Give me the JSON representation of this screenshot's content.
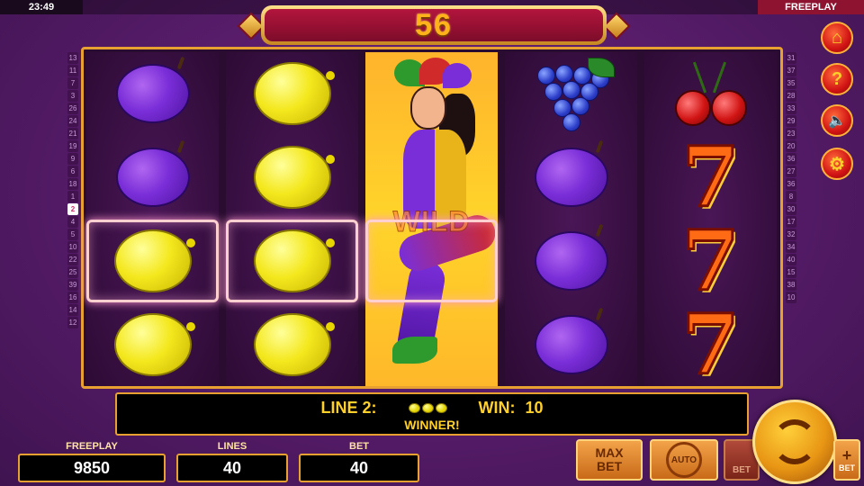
{
  "status": {
    "time": "23:49",
    "mode": "FREEPLAY"
  },
  "win_counter": "56",
  "line_numbers": {
    "left": [
      "13",
      "11",
      "7",
      "3",
      "26",
      "24",
      "21",
      "19",
      "9",
      "6",
      "18",
      "1",
      "2",
      "4",
      "5",
      "10",
      "22",
      "25",
      "39",
      "16",
      "14",
      "12"
    ],
    "right": [
      "31",
      "37",
      "35",
      "28",
      "33",
      "29",
      "23",
      "20",
      "36",
      "27",
      "36",
      "8",
      "30",
      "17",
      "32",
      "34",
      "40",
      "15",
      "38",
      "10"
    ],
    "active_left": "2"
  },
  "reels": [
    [
      "plum",
      "plum",
      "lemon",
      "lemon"
    ],
    [
      "lemon",
      "lemon",
      "lemon",
      "lemon"
    ],
    [
      "wild"
    ],
    [
      "grapes",
      "plum",
      "plum",
      "plum"
    ],
    [
      "cherries",
      "seven",
      "seven",
      "seven"
    ]
  ],
  "wild_label": "WILD",
  "info": {
    "line_label": "LINE 2:",
    "win_label": "WIN:",
    "win_value": "10",
    "message": "WINNER!"
  },
  "stats": {
    "freeplay_label": "FREEPLAY",
    "freeplay_value": "9850",
    "lines_label": "LINES",
    "lines_value": "40",
    "bet_label": "BET",
    "bet_value": "40"
  },
  "controls": {
    "max_label": "MAX",
    "bet_label": "BET",
    "auto_label": "AUTO",
    "bet_minus_label": "BET",
    "bet_plus_label": "BET",
    "plus_symbol": "+"
  },
  "icons": [
    "home-icon",
    "help-icon",
    "mute-icon",
    "settings-icon",
    "spin-icon"
  ]
}
